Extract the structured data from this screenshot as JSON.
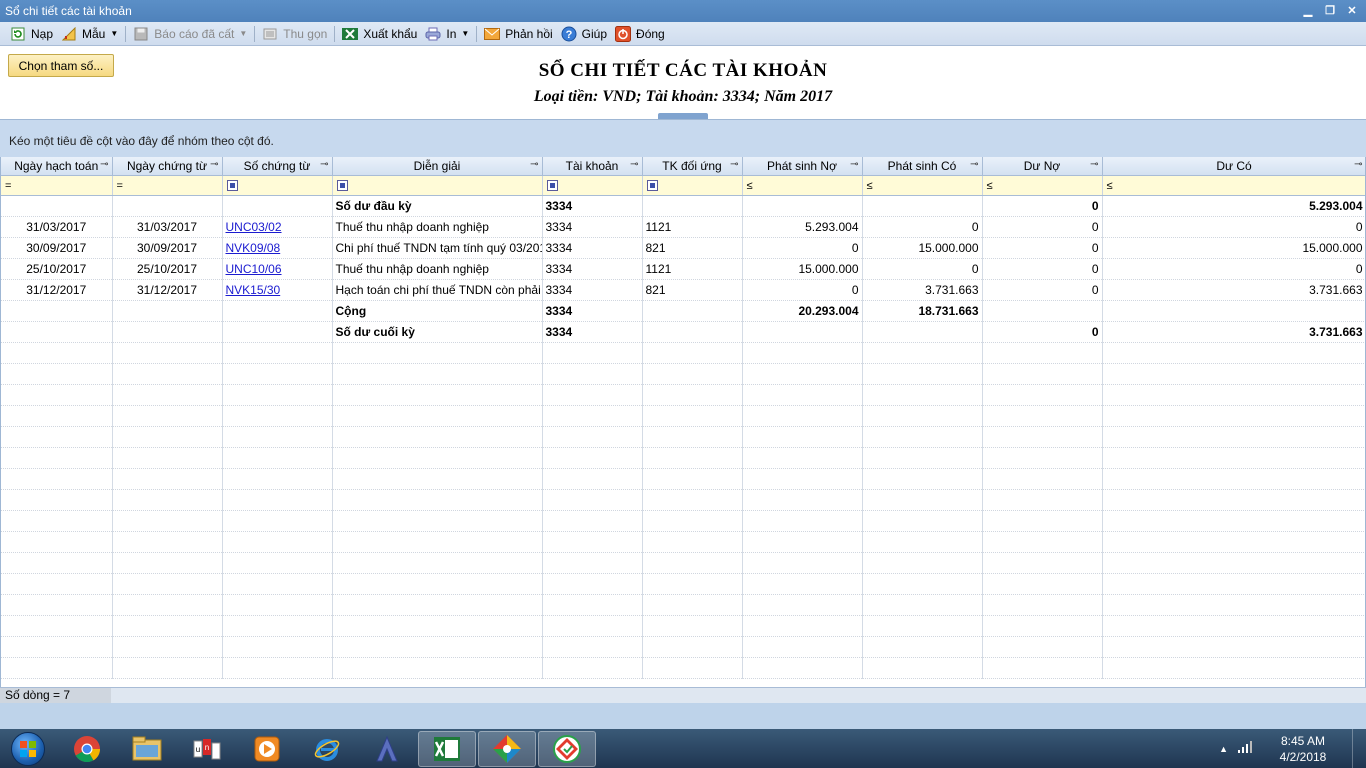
{
  "window": {
    "title": "Sổ chi tiết các tài khoản"
  },
  "toolbar": {
    "nap": "Nạp",
    "mau": "Mẫu",
    "bao_cao_da_cat": "Báo cáo đã cất",
    "thu_gon": "Thu gọn",
    "xuat_khau": "Xuất khẩu",
    "in": "In",
    "phan_hoi": "Phản hồi",
    "giup": "Giúp",
    "dong": "Đóng"
  },
  "params_button": "Chọn tham số...",
  "report": {
    "title": "SỔ CHI TIẾT CÁC TÀI KHOẢN",
    "subtitle": "Loại tiền: VND; Tài khoản: 3334; Năm 2017"
  },
  "group_panel_hint": "Kéo một tiêu đề cột vào đây để nhóm theo cột đó.",
  "columns": [
    "Ngày hạch toán",
    "Ngày chứng từ",
    "Số chứng từ",
    "Diễn giải",
    "Tài khoản",
    "TK đối ứng",
    "Phát sinh Nợ",
    "Phát sinh Có",
    "Dư Nợ",
    "Dư Có"
  ],
  "filter_ops": {
    "eq": "=",
    "le": "≤"
  },
  "rows": [
    {
      "bold": true,
      "ngay_ht": "",
      "ngay_ct": "",
      "so_ct": "",
      "dien_giai": "Số dư đầu kỳ",
      "tk": "3334",
      "tk_du": "",
      "ps_no": "",
      "ps_co": "",
      "du_no": "0",
      "du_co": "5.293.004"
    },
    {
      "bold": false,
      "ngay_ht": "31/03/2017",
      "ngay_ct": "31/03/2017",
      "so_ct": "UNC03/02",
      "dien_giai": "Thuế thu nhập doanh nghiệp",
      "tk": "3334",
      "tk_du": "1121",
      "ps_no": "5.293.004",
      "ps_co": "0",
      "du_no": "0",
      "du_co": "0"
    },
    {
      "bold": false,
      "ngay_ht": "30/09/2017",
      "ngay_ct": "30/09/2017",
      "so_ct": "NVK09/08",
      "dien_giai": "Chi phí thuế TNDN tạm tính quý 03/201",
      "tk": "3334",
      "tk_du": "821",
      "ps_no": "0",
      "ps_co": "15.000.000",
      "du_no": "0",
      "du_co": "15.000.000"
    },
    {
      "bold": false,
      "ngay_ht": "25/10/2017",
      "ngay_ct": "25/10/2017",
      "so_ct": "UNC10/06",
      "dien_giai": "Thuế thu nhập doanh nghiệp",
      "tk": "3334",
      "tk_du": "1121",
      "ps_no": "15.000.000",
      "ps_co": "0",
      "du_no": "0",
      "du_co": "0"
    },
    {
      "bold": false,
      "ngay_ht": "31/12/2017",
      "ngay_ct": "31/12/2017",
      "so_ct": "NVK15/30",
      "dien_giai": "Hạch toán chi phí thuế TNDN còn phải",
      "tk": "3334",
      "tk_du": "821",
      "ps_no": "0",
      "ps_co": "3.731.663",
      "du_no": "0",
      "du_co": "3.731.663"
    },
    {
      "bold": true,
      "ngay_ht": "",
      "ngay_ct": "",
      "so_ct": "",
      "dien_giai": "Cộng",
      "tk": "3334",
      "tk_du": "",
      "ps_no": "20.293.004",
      "ps_co": "18.731.663",
      "du_no": "",
      "du_co": ""
    },
    {
      "bold": true,
      "ngay_ht": "",
      "ngay_ct": "",
      "so_ct": "",
      "dien_giai": "Số dư cuối kỳ",
      "tk": "3334",
      "tk_du": "",
      "ps_no": "",
      "ps_co": "",
      "du_no": "0",
      "du_co": "3.731.663"
    }
  ],
  "status": {
    "row_count": "Số dòng = 7"
  },
  "taskbar": {
    "clock_time": "8:45 AM",
    "clock_date": "4/2/2018",
    "apps": [
      "chrome-icon",
      "file-explorer-icon",
      "unikey-icon",
      "media-player-icon",
      "internet-explorer-icon",
      "autocad-icon",
      "excel-icon",
      "misa-app-icon",
      "misa-active-icon"
    ]
  },
  "colors": {
    "title_bar": "#5b8fc7",
    "group_panel": "#c7d9ee",
    "filter_row": "#fffbd7",
    "link": "#1b1bd0"
  }
}
